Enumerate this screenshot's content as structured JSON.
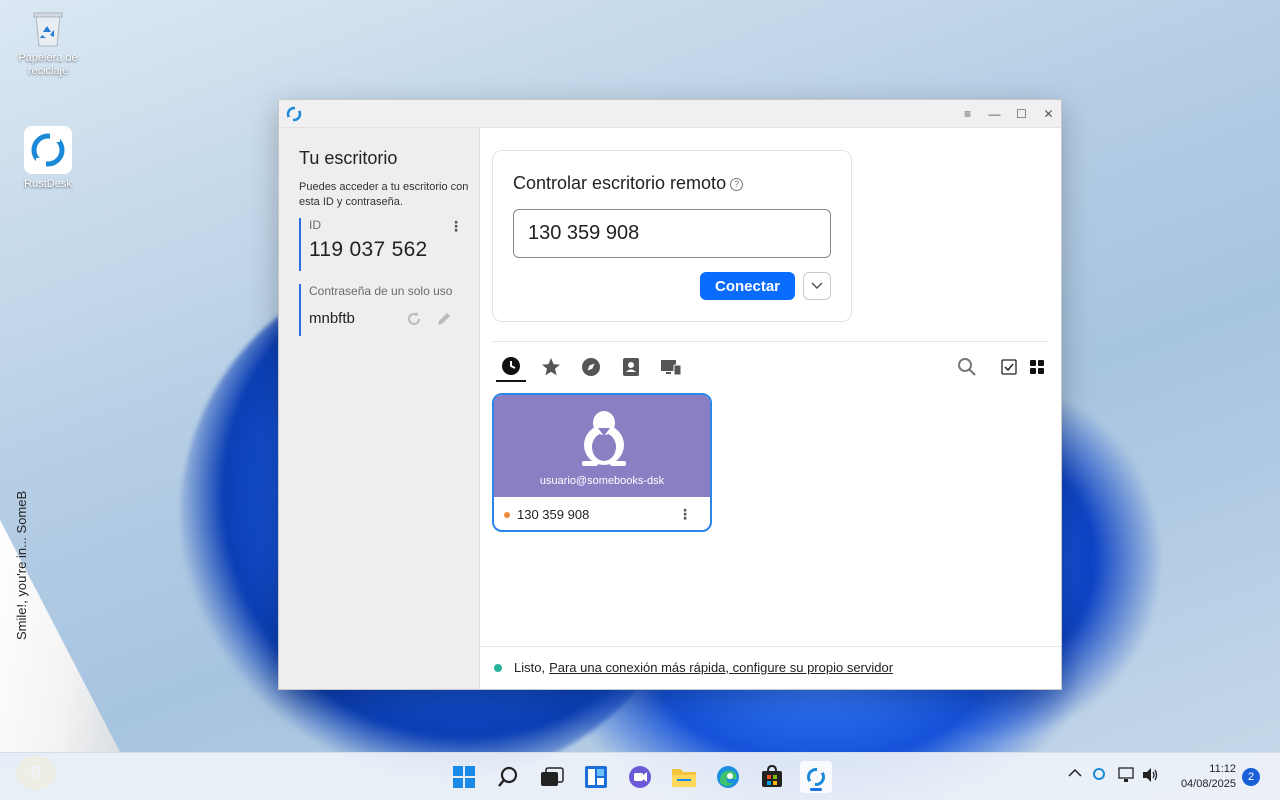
{
  "desktop": {
    "icons": [
      {
        "label": "Papelera de reciclaje"
      },
      {
        "label": "RustDesk"
      }
    ],
    "watermark_brand": "Smile!, you're in... SomeB",
    "badge_letter": "B"
  },
  "window": {
    "controls": {
      "menu": "≡",
      "minimize": "—",
      "maximize": "☐",
      "close": "✕"
    },
    "left": {
      "title": "Tu escritorio",
      "description": "Puedes acceder a tu escritorio con esta ID y contraseña.",
      "id_label": "ID",
      "id_value": "119 037 562",
      "password_label": "Contraseña de un solo uso",
      "password_value": "mnbftb"
    },
    "connect_card": {
      "title": "Controlar escritorio remoto",
      "help": "?",
      "id_value": "130 359 908",
      "connect_label": "Conectar"
    },
    "tabs": [
      {
        "name": "recent",
        "icon": "clock-icon",
        "active": true
      },
      {
        "name": "favorites",
        "icon": "star-icon"
      },
      {
        "name": "discovered",
        "icon": "compass-icon"
      },
      {
        "name": "address-book",
        "icon": "contact-icon"
      },
      {
        "name": "devices",
        "icon": "devices-icon"
      }
    ],
    "peer": {
      "user": "usuario@somebooks-dsk",
      "id": "130 359 908",
      "os_icon": "linux-penguin-icon",
      "status_color": "#f08a3c"
    },
    "status": {
      "text": "Listo,",
      "link": "Para una conexión más rápida, configure su propio servidor",
      "color": "#2ab39b"
    }
  },
  "taskbar": {
    "apps": [
      "start",
      "search",
      "task-view",
      "widgets",
      "teams",
      "file-explorer",
      "edge",
      "store",
      "rustdesk"
    ],
    "time": "11:12",
    "date": "04/08/2025",
    "notifications": "2"
  },
  "colors": {
    "accent": "#0a6cff",
    "peer_card": "#8a7fc2"
  }
}
